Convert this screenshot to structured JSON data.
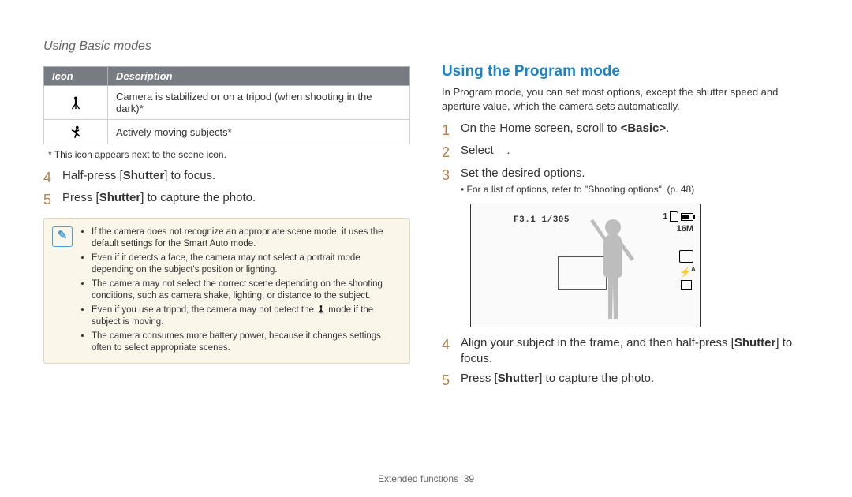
{
  "header": "Using Basic modes",
  "table": {
    "headers": [
      "Icon",
      "Description"
    ],
    "rows": [
      {
        "iconName": "tripod-person-icon",
        "desc": "Camera is stabilized or on a tripod (when shooting in the dark)*"
      },
      {
        "iconName": "running-person-icon",
        "desc": "Actively moving subjects*"
      }
    ]
  },
  "tableFootnote": "* This icon appears next to the scene icon.",
  "leftSteps": [
    {
      "n": "4",
      "html": "Half-press [<b>Shutter</b>] to focus."
    },
    {
      "n": "5",
      "html": "Press [<b>Shutter</b>] to capture the photo."
    }
  ],
  "noteBullets": [
    "If the camera does not recognize an appropriate scene mode, it uses the default settings for the Smart Auto mode.",
    "Even if it detects a face, the camera may not select a portrait mode depending on the subject's position or lighting.",
    "The camera may not select the correct scene depending on the shooting conditions, such as camera shake, lighting, or distance to the subject.",
    "Even if you use a tripod, the camera may not detect the __TRIPOD_ICON__ mode if the subject is moving.",
    "The camera consumes more battery power, because it changes settings often to select appropriate scenes."
  ],
  "rightHeading": "Using the Program mode",
  "rightIntro": "In Program mode, you can set most options, except the shutter speed and aperture value, which the camera sets automatically.",
  "rightSteps": [
    {
      "n": "1",
      "html": "On the Home screen, scroll to <b>&lt;Basic&gt;</b>."
    },
    {
      "n": "2",
      "html": "Select &nbsp;&nbsp;&nbsp;."
    },
    {
      "n": "3",
      "html": "Set the desired options.",
      "sub": "For a list of options, refer to \"Shooting options\". (p. 48)"
    },
    {
      "n": "4",
      "html": "Align your subject in the frame, and then half-press [<b>Shutter</b>] to focus."
    },
    {
      "n": "5",
      "html": "Press [<b>Shutter</b>] to capture the photo."
    }
  ],
  "cameraDisplay": {
    "exposure": "F3.1  1/305",
    "topNumber": "1",
    "resolution": "16M",
    "flash": "A"
  },
  "footer": {
    "section": "Extended functions",
    "page": "39"
  }
}
